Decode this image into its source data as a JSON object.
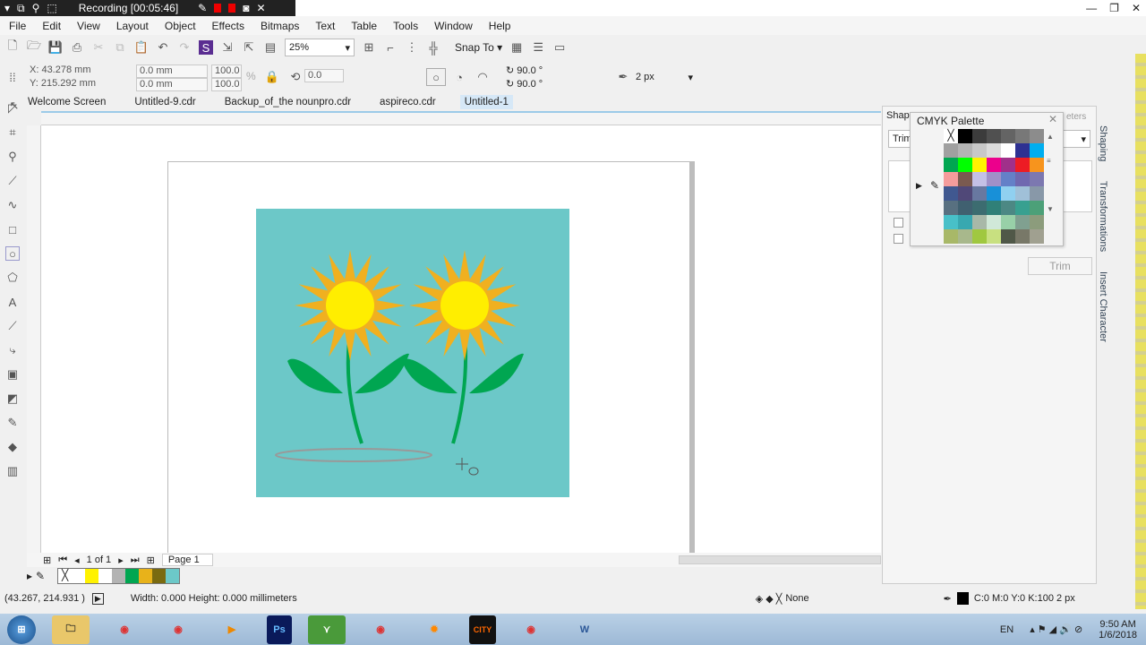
{
  "recording": {
    "label": "Recording [00:05:46]"
  },
  "menu": [
    "File",
    "Edit",
    "View",
    "Layout",
    "Object",
    "Effects",
    "Bitmaps",
    "Text",
    "Table",
    "Tools",
    "Window",
    "Help"
  ],
  "toolbar": {
    "zoom": "25%",
    "snap_to": "Snap To"
  },
  "property_bar": {
    "x": "X: 43.278 mm",
    "y": "Y: 215.292 mm",
    "w": "0.0 mm",
    "h": "0.0 mm",
    "sx": "100.0",
    "sy": "100.0",
    "pct": "%",
    "rotation": "0.0",
    "start_angle": "90.0 °",
    "end_angle": "90.0 °",
    "outline": "2 px"
  },
  "tabs": [
    "Welcome Screen",
    "Untitled-9.cdr",
    "Backup_of_the nounpro.cdr",
    "aspireco.cdr",
    "Untitled-1"
  ],
  "page_nav": {
    "count": "1 of 1",
    "page": "Page 1"
  },
  "doc_palette": [
    "#ffffff",
    "#fff200",
    "#ffffff",
    "#b3b3b3",
    "#00a651",
    "#e8b21a",
    "#7a6a10",
    "#6cc8c8"
  ],
  "docker": {
    "title": "Shap",
    "dropdown": "Trim",
    "button": "Trim",
    "tabs": [
      "Shaping",
      "Transformations",
      "Insert Character"
    ],
    "hint": "eters"
  },
  "cmyk_palette": {
    "title": "CMYK Palette",
    "colors": [
      "none",
      "#000000",
      "#3c3c3c",
      "#505050",
      "#646464",
      "#787878",
      "#8c8c8c",
      "#a0a0a0",
      "#b4b4b4",
      "#c8c8c8",
      "#dcdcdc",
      "#ffffff",
      "#2e3192",
      "#00aeef",
      "#00a651",
      "#00ff00",
      "#fff200",
      "#ec008c",
      "#a0308a",
      "#ed1c24",
      "#f7941d",
      "#f49c9c",
      "#7a5a50",
      "#c4c0e6",
      "#a090c8",
      "#6480c8",
      "#7068b0",
      "#7c78b0",
      "#405890",
      "#504878",
      "#6878a0",
      "#1890d8",
      "#90d0f0",
      "#a0c0d8",
      "#8898a8",
      "#587080",
      "#406070",
      "#3c6c70",
      "#308078",
      "#4c8884",
      "#38a090",
      "#4ca078",
      "#48c0c8",
      "#38a8b0",
      "#a8b8a8",
      "#d0e8d8",
      "#98d0a8",
      "#80a090",
      "#8c9c7c",
      "#a8b868",
      "#a8b88c",
      "#a0c840",
      "#c8e080",
      "#505848",
      "#787868",
      "#a0a090"
    ]
  },
  "status": {
    "coords": "(43.267, 214.931 )",
    "size": "Width: 0.000  Height: 0.000  millimeters",
    "fill": "None",
    "outline": "C:0 M:0 Y:0 K:100  2 px"
  },
  "taskbar": {
    "lang": "EN",
    "time": "9:50 AM",
    "date": "1/6/2018"
  },
  "artwork": {
    "background": "#6cc8c8",
    "petal": "#f0b020",
    "center": "#ffee00",
    "leaf": "#00a651"
  }
}
